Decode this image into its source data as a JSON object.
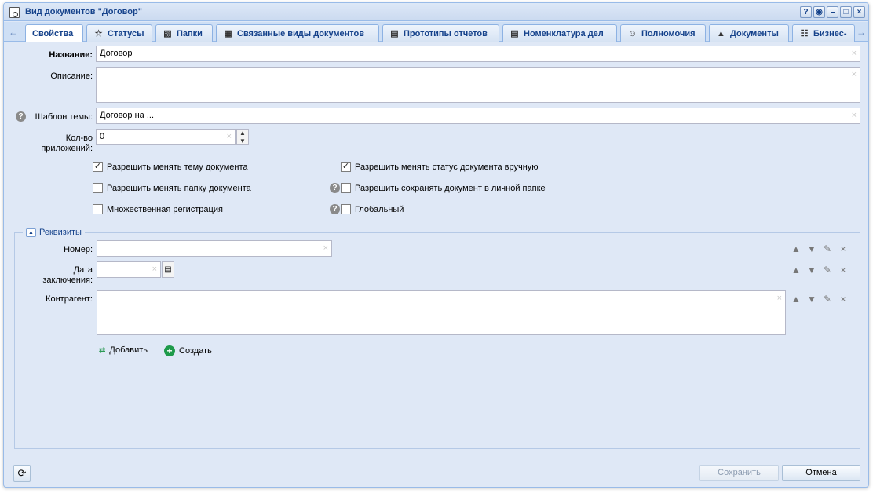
{
  "window": {
    "title": "Вид документов \"Договор\"",
    "tools": [
      "help-icon",
      "binoculars-icon",
      "minimize-icon",
      "maximize-icon",
      "close-icon"
    ]
  },
  "tabs": [
    {
      "label": "Свойства",
      "icon": "none"
    },
    {
      "label": "Статусы",
      "icon": "star-icon"
    },
    {
      "label": "Папки",
      "icon": "folder-icon"
    },
    {
      "label": "Связанные виды документов",
      "icon": "linked-doc-icon"
    },
    {
      "label": "Прототипы отчетов",
      "icon": "report-icon"
    },
    {
      "label": "Номенклатура дел",
      "icon": "nomenclature-icon"
    },
    {
      "label": "Полномочия",
      "icon": "user-permissions-icon"
    },
    {
      "label": "Документы",
      "icon": "documents-icon"
    },
    {
      "label": "Бизнес-",
      "icon": "org-structure-icon"
    }
  ],
  "form": {
    "name_label": "Название:",
    "name_value": "Договор",
    "description_label": "Описание:",
    "description_value": "",
    "subject_template_label": "Шаблон темы:",
    "subject_template_value": "Договор на ...",
    "attachments_label_line1": "Кол-во",
    "attachments_label_line2": "приложений:",
    "attachments_value": "0",
    "checkboxes": [
      {
        "label": "Разрешить менять тему документа",
        "checked": true
      },
      {
        "label": "Разрешить менять статус документа вручную",
        "checked": true
      },
      {
        "label": "Разрешить менять папку документа",
        "checked": false
      },
      {
        "label": "Разрешить сохранять документ в личной папке",
        "checked": false
      },
      {
        "label": "Множественная регистрация",
        "checked": false
      },
      {
        "label": "Глобальный",
        "checked": false
      }
    ]
  },
  "requisites": {
    "legend": "Реквизиты",
    "number_label": "Номер:",
    "number_value": "",
    "date_label_line1": "Дата",
    "date_label_line2": "заключения:",
    "date_value": "",
    "counterparty_label": "Контрагент:",
    "counterparty_value": "",
    "add_label": "Добавить",
    "create_label": "Создать"
  },
  "footer": {
    "save_label": "Сохранить",
    "cancel_label": "Отмена"
  }
}
